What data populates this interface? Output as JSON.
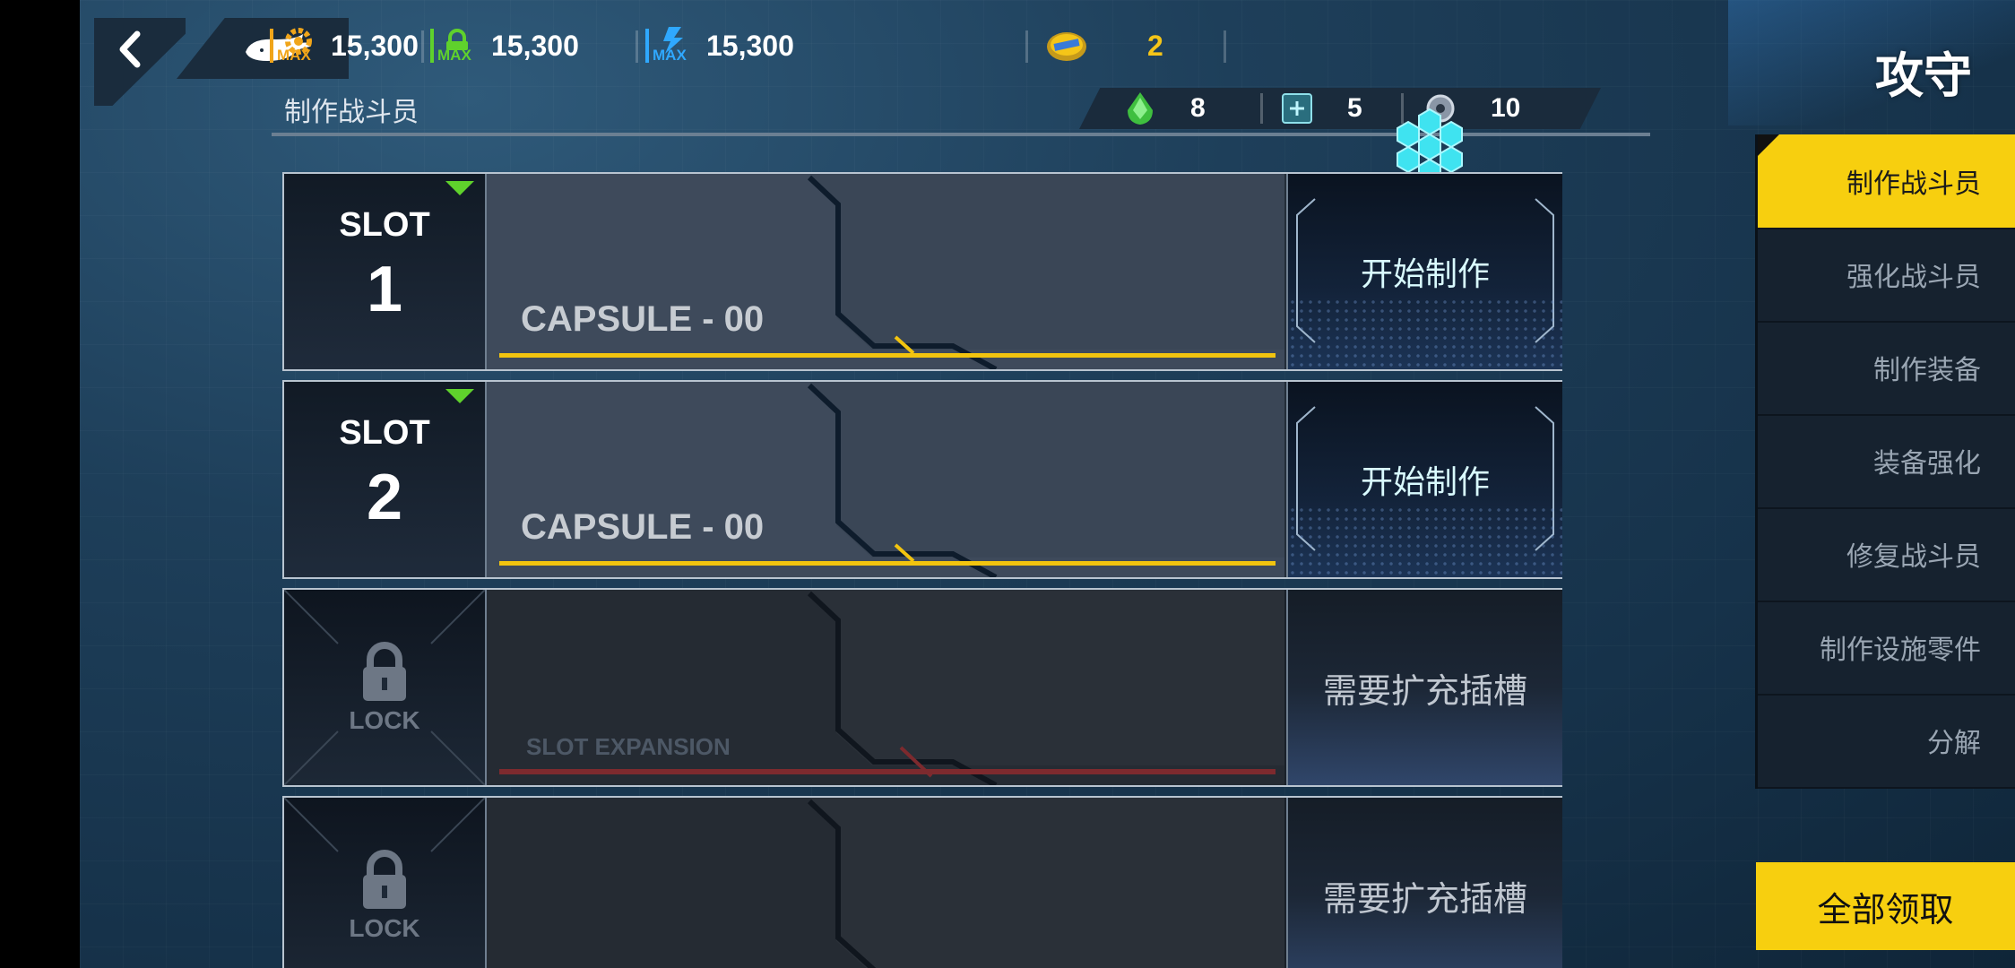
{
  "topbar": {
    "resources": [
      {
        "icon": "gear-max-icon",
        "tag": "MAX",
        "value": "15,300",
        "color": "#f0a51a"
      },
      {
        "icon": "lock-max-icon",
        "tag": "MAX",
        "value": "15,300",
        "color": "#5fd12c"
      },
      {
        "icon": "bolt-max-icon",
        "tag": "MAX",
        "value": "15,300",
        "color": "#2fa8ff"
      }
    ],
    "coin": {
      "icon": "coin-icon",
      "value": "2",
      "color": "#f5c518"
    }
  },
  "page_title": "制作战斗员",
  "mode_label": "攻守",
  "materials": [
    {
      "icon": "green-crystal-icon",
      "value": "8"
    },
    {
      "icon": "circuit-chip-icon",
      "value": "5"
    },
    {
      "icon": "gear-bolt-icon",
      "value": "10"
    }
  ],
  "slots": [
    {
      "label": "SLOT",
      "number": "1",
      "capsule": "CAPSULE - 00",
      "action": "开始制作"
    },
    {
      "label": "SLOT",
      "number": "2",
      "capsule": "CAPSULE - 00",
      "action": "开始制作"
    },
    {
      "lock_label": "LOCK",
      "capsule": "SLOT EXPANSION",
      "action": "需要扩充插槽"
    },
    {
      "lock_label": "LOCK",
      "capsule": "",
      "action": "需要扩充插槽"
    }
  ],
  "menu": {
    "items": [
      "制作战斗员",
      "强化战斗员",
      "制作装备",
      "装备强化",
      "修复战斗员",
      "制作设施零件",
      "分解"
    ],
    "active_index": 0
  },
  "claim_all": "全部领取",
  "colors": {
    "accent": "#f7cf0f",
    "capsule_line": "#f2c40f",
    "locked_line": "#7d2a2e"
  }
}
